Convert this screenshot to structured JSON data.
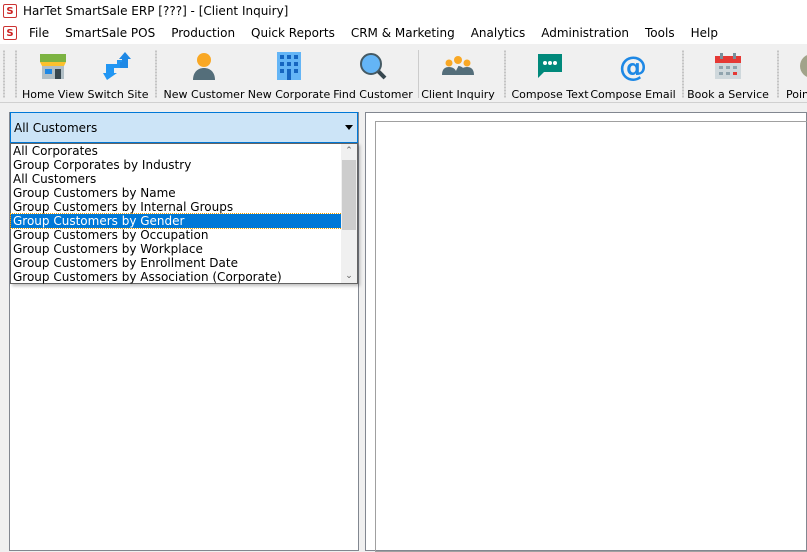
{
  "window": {
    "title": "HarTet SmartSale ERP [???] - [Client Inquiry]",
    "logo": "S"
  },
  "menu": [
    "File",
    "SmartSale POS",
    "Production",
    "Quick Reports",
    "CRM & Marketing",
    "Analytics",
    "Administration",
    "Tools",
    "Help"
  ],
  "toolbar": [
    {
      "label": "Home View",
      "icon": "store-icon"
    },
    {
      "label": "Switch Site",
      "icon": "switch-arrows-icon"
    },
    {
      "label": "New Customer",
      "icon": "person-icon"
    },
    {
      "label": "New Corporate",
      "icon": "building-icon"
    },
    {
      "label": "Find Customer",
      "icon": "magnifier-icon"
    },
    {
      "label": "Client Inquiry",
      "icon": "group-icon"
    },
    {
      "label": "Compose Text",
      "icon": "chat-icon"
    },
    {
      "label": "Compose Email",
      "icon": "at-icon"
    },
    {
      "label": "Book a Service",
      "icon": "calendar-icon"
    },
    {
      "label": "Poin",
      "icon": "point-icon"
    }
  ],
  "filter": {
    "selected": "All Customers",
    "options": [
      "All Corporates",
      "Group Corporates by Industry",
      "All Customers",
      "Group Customers by Name",
      "Group Customers by Internal Groups",
      "Group Customers by Gender",
      "Group Customers by Occupation",
      "Group Customers by Workplace",
      "Group Customers by Enrollment Date",
      "Group Customers by Association (Corporate)"
    ],
    "highlighted": "Group Customers by Gender"
  },
  "colors": {
    "highlight": "#0078d7",
    "combo_bg": "#cce4f7"
  }
}
